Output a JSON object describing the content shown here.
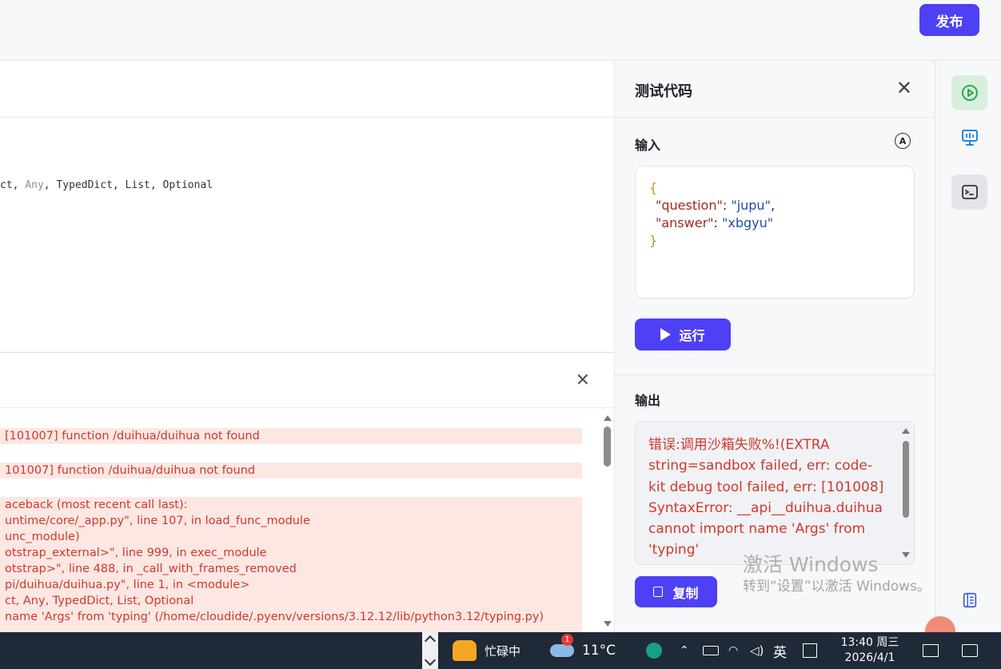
{
  "header": {
    "publish_label": "发布"
  },
  "editor": {
    "code_prefix": "ct, ",
    "code_dim": "Any",
    "code_rest": ", TypedDict, List, Optional"
  },
  "log": {
    "entries": [
      " [101007] function /duihua/duihua not found",
      "101007] function /duihua/duihua not found",
      "aceback (most recent call last):",
      "untime/core/_app.py\", line 107, in load_func_module",
      "unc_module)",
      "otstrap_external>\", line 999, in exec_module",
      "otstrap>\", line 488, in _call_with_frames_removed",
      "pi/duihua/duihua.py\", line 1, in <module>",
      "ct, Any, TypedDict, List, Optional",
      "name 'Args' from 'typing' (/home/cloudide/.pyenv/versions/3.12.12/lib/python3.12/typing.py)"
    ]
  },
  "test_panel": {
    "title": "测试代码",
    "input_label": "输入",
    "auto_icon": "A",
    "json_open": "{",
    "json_key1": "\"question\"",
    "json_val1": "\"jupu\"",
    "json_key2": "\"answer\"",
    "json_val2": "\"xbgyu\"",
    "json_close": "}",
    "run_label": "运行",
    "output_label": "输出",
    "output_text": "错误:调用沙箱失败%!(EXTRA string=sandbox failed, err: code-kit debug tool failed, err: [101008] SyntaxError: __api__duihua.duihua cannot import name 'Args' from 'typing'",
    "copy_label": "复制"
  },
  "watermark": {
    "line1": "激活 Windows",
    "line2": "转到“设置”以激活 Windows。"
  },
  "taskbar": {
    "busy_label": "忙碌中",
    "weather_badge": "1",
    "temperature": "11°C",
    "ime_label": "英",
    "time": "13:40 周三",
    "date": "2026/4/1"
  },
  "icons": {
    "rail": [
      "play-circle-icon",
      "monitor-icon",
      "terminal-icon",
      "book-icon"
    ],
    "accent": "#4e40f5"
  }
}
